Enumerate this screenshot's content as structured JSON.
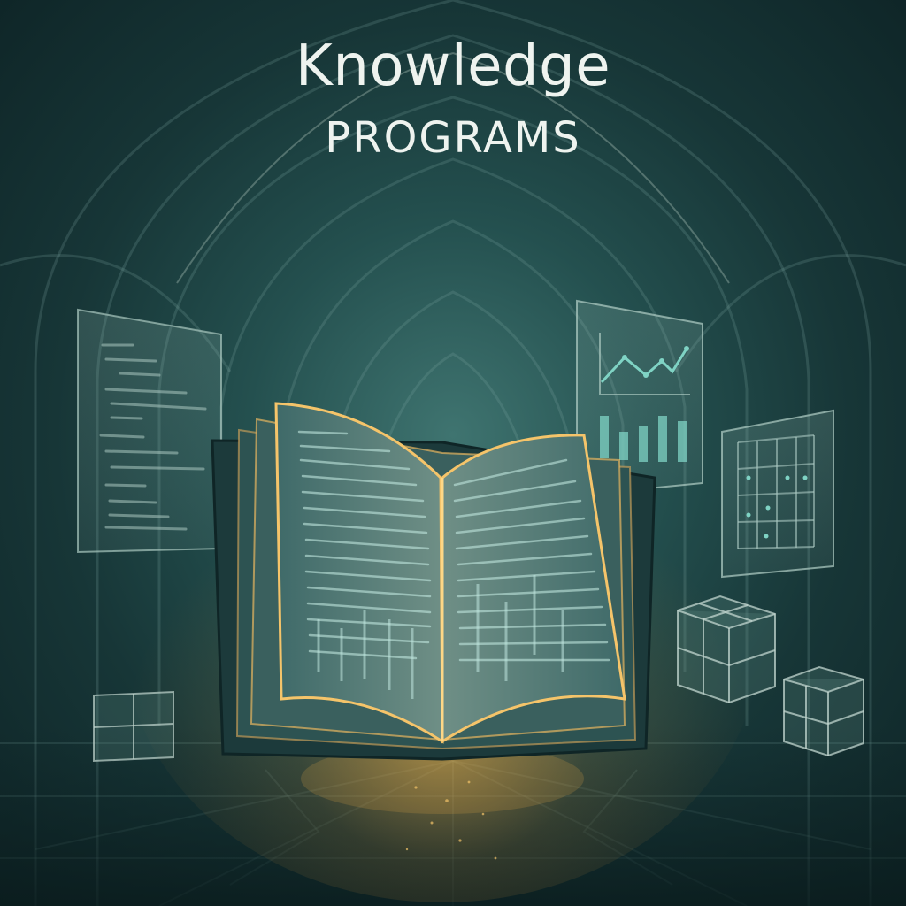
{
  "title": {
    "line1": "Knowledge",
    "line2": "PROGRAMS"
  },
  "colors": {
    "background": "#173637",
    "glow": "#f2b24a",
    "accent_teal": "#7fd3c4",
    "title_text": "#eef3ef"
  },
  "illustration": {
    "subject": "open-book-icon",
    "panels": [
      "code-panel-icon",
      "chart-panel-icon",
      "grid-panel-icon"
    ],
    "cubes": [
      "cube-icon",
      "cube-icon",
      "cube-icon"
    ]
  }
}
